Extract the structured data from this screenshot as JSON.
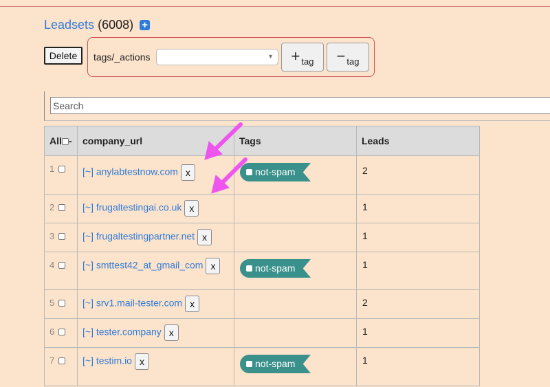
{
  "header": {
    "title_link": "Leadsets",
    "count": "(6008)",
    "add_icon": "plus-square-icon",
    "accent_color": "#2f7bd8"
  },
  "toolbar": {
    "delete_label": "Delete",
    "tags_label": "tags/_actions",
    "tag_select_value": "",
    "add_tag_symbol": "+",
    "add_tag_label": "tag",
    "remove_tag_symbol": "−",
    "remove_tag_label": "tag"
  },
  "search": {
    "placeholder": "Search"
  },
  "table": {
    "headers": {
      "all": "All",
      "all_suffix": "-",
      "company_url": "company_url",
      "tags": "Tags",
      "leads": "Leads"
    },
    "rows": [
      {
        "num": "1",
        "url": "[~] anylabtestnow.com",
        "x": "x",
        "tag": "not-spam",
        "leads": "2"
      },
      {
        "num": "2",
        "url": "[~] frugaltestingai.co.uk",
        "x": "x",
        "tag": "",
        "leads": "1"
      },
      {
        "num": "3",
        "url": "[~] frugaltestingpartner.net",
        "x": "x",
        "tag": "",
        "leads": "1"
      },
      {
        "num": "4",
        "url": "[~] smttest42_at_gmail_com",
        "x": "x",
        "tag": "not-spam",
        "leads": "1"
      },
      {
        "num": "5",
        "url": "[~] srv1.mail-tester.com",
        "x": "x",
        "tag": "",
        "leads": "2"
      },
      {
        "num": "6",
        "url": "[~] tester.company",
        "x": "x",
        "tag": "",
        "leads": "1"
      },
      {
        "num": "7",
        "url": "[~] testim.io",
        "x": "x",
        "tag": "not-spam",
        "leads": "1"
      }
    ]
  },
  "colors": {
    "background": "#fce3cb",
    "tag_pill": "#3a908a",
    "annotation_arrow": "#ee55ee"
  }
}
